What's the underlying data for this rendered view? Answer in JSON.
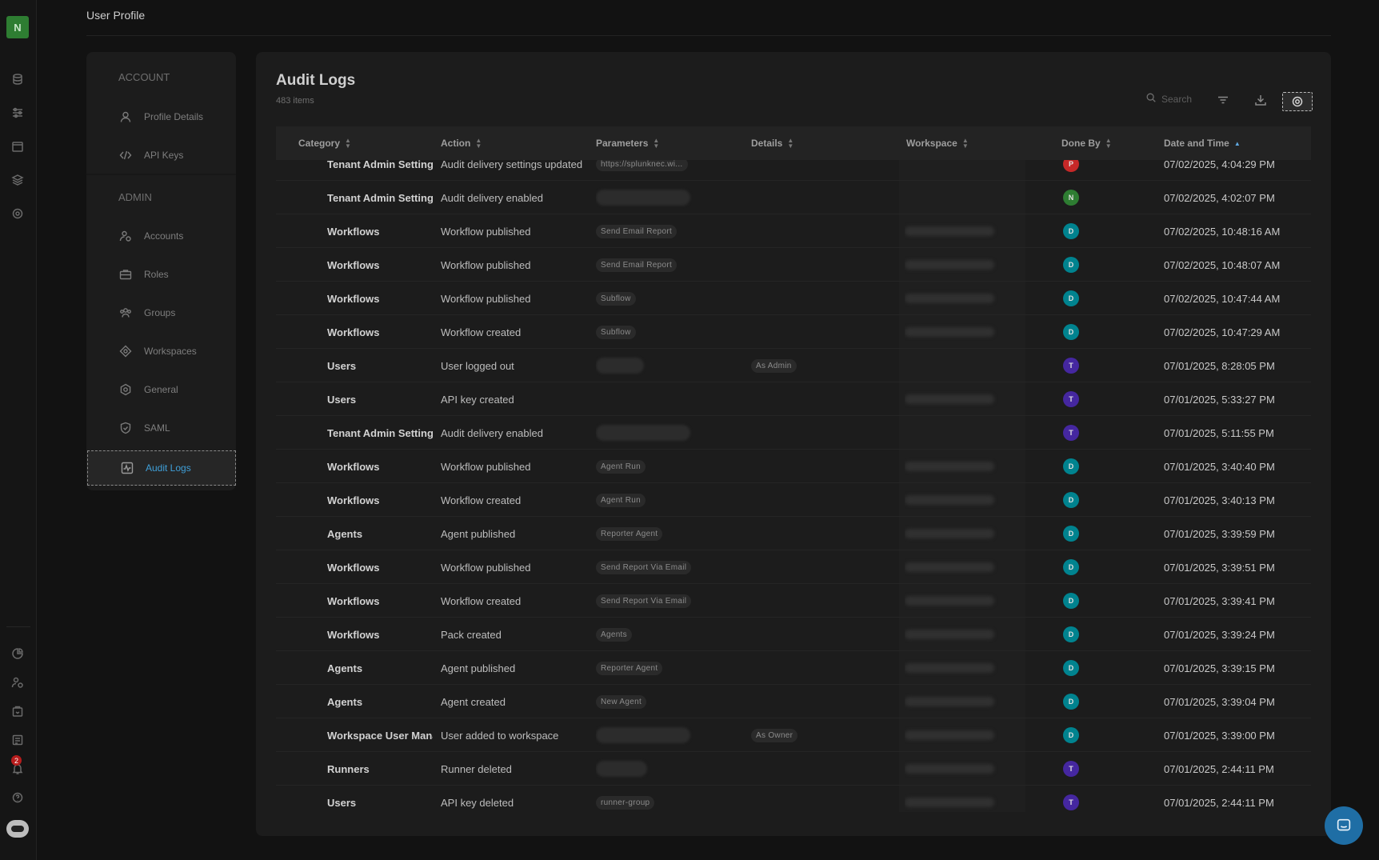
{
  "app": {
    "logo_letter": "N",
    "page_title": "User Profile",
    "notification_count": "2"
  },
  "nav": {
    "account_label": "ACCOUNT",
    "admin_label": "ADMIN",
    "account_items": [
      {
        "label": "Profile Details",
        "icon": "user-icon"
      },
      {
        "label": "API Keys",
        "icon": "code-icon"
      }
    ],
    "admin_items": [
      {
        "label": "Accounts",
        "icon": "accounts-icon"
      },
      {
        "label": "Roles",
        "icon": "briefcase-icon"
      },
      {
        "label": "Groups",
        "icon": "groups-icon"
      },
      {
        "label": "Workspaces",
        "icon": "workspace-icon"
      },
      {
        "label": "General",
        "icon": "gear-icon"
      },
      {
        "label": "SAML",
        "icon": "shield-icon"
      },
      {
        "label": "Audit Logs",
        "icon": "activity-icon",
        "active": true
      }
    ]
  },
  "audit": {
    "title": "Audit Logs",
    "count": "483 items",
    "search_placeholder": "Search",
    "columns": [
      "Category",
      "Action",
      "Parameters",
      "Details",
      "Workspace",
      "Done By",
      "Date and Time"
    ],
    "rows": [
      {
        "category": "Tenant Admin Setting",
        "action": "Audit delivery settings updated",
        "param": "https://splunknec.wi...",
        "param_blur": false,
        "details": "",
        "ws": false,
        "avatar": "P",
        "color": "#c62828",
        "date": "07/02/2025, 4:04:29 PM"
      },
      {
        "category": "Tenant Admin Setting",
        "action": "Audit delivery enabled",
        "param": "",
        "param_blur": true,
        "blur_w": 118,
        "details": "",
        "ws": false,
        "avatar": "N",
        "color": "#2e7d32",
        "date": "07/02/2025, 4:02:07 PM"
      },
      {
        "category": "Workflows",
        "action": "Workflow published",
        "param": "Send Email Report",
        "details": "",
        "ws": true,
        "avatar": "D",
        "color": "#00838f",
        "date": "07/02/2025, 10:48:16 AM"
      },
      {
        "category": "Workflows",
        "action": "Workflow published",
        "param": "Send Email Report",
        "details": "",
        "ws": true,
        "avatar": "D",
        "color": "#00838f",
        "date": "07/02/2025, 10:48:07 AM"
      },
      {
        "category": "Workflows",
        "action": "Workflow published",
        "param": "Subflow",
        "details": "",
        "ws": true,
        "avatar": "D",
        "color": "#00838f",
        "date": "07/02/2025, 10:47:44 AM"
      },
      {
        "category": "Workflows",
        "action": "Workflow created",
        "param": "Subflow",
        "details": "",
        "ws": true,
        "avatar": "D",
        "color": "#00838f",
        "date": "07/02/2025, 10:47:29 AM"
      },
      {
        "category": "Users",
        "action": "User logged out",
        "param": "",
        "param_blur": true,
        "blur_w": 60,
        "details": "As Admin",
        "ws": false,
        "avatar": "T",
        "color": "#4527a0",
        "date": "07/01/2025, 8:28:05 PM"
      },
      {
        "category": "Users",
        "action": "API key created",
        "param": "",
        "param_blur": false,
        "details": "",
        "ws": true,
        "avatar": "T",
        "color": "#4527a0",
        "date": "07/01/2025, 5:33:27 PM"
      },
      {
        "category": "Tenant Admin Setting",
        "action": "Audit delivery enabled",
        "param": "",
        "param_blur": true,
        "blur_w": 118,
        "details": "",
        "ws": false,
        "avatar": "T",
        "color": "#4527a0",
        "date": "07/01/2025, 5:11:55 PM"
      },
      {
        "category": "Workflows",
        "action": "Workflow published",
        "param": "Agent Run",
        "details": "",
        "ws": true,
        "avatar": "D",
        "color": "#00838f",
        "date": "07/01/2025, 3:40:40 PM"
      },
      {
        "category": "Workflows",
        "action": "Workflow created",
        "param": "Agent Run",
        "details": "",
        "ws": true,
        "avatar": "D",
        "color": "#00838f",
        "date": "07/01/2025, 3:40:13 PM"
      },
      {
        "category": "Agents",
        "action": "Agent published",
        "param": "Reporter Agent",
        "details": "",
        "ws": true,
        "avatar": "D",
        "color": "#00838f",
        "date": "07/01/2025, 3:39:59 PM"
      },
      {
        "category": "Workflows",
        "action": "Workflow published",
        "param": "Send Report Via Email",
        "details": "",
        "ws": true,
        "avatar": "D",
        "color": "#00838f",
        "date": "07/01/2025, 3:39:51 PM"
      },
      {
        "category": "Workflows",
        "action": "Workflow created",
        "param": "Send Report Via Email",
        "details": "",
        "ws": true,
        "avatar": "D",
        "color": "#00838f",
        "date": "07/01/2025, 3:39:41 PM"
      },
      {
        "category": "Workflows",
        "action": "Pack created",
        "param": "Agents",
        "details": "",
        "ws": true,
        "avatar": "D",
        "color": "#00838f",
        "date": "07/01/2025, 3:39:24 PM"
      },
      {
        "category": "Agents",
        "action": "Agent published",
        "param": "Reporter Agent",
        "details": "",
        "ws": true,
        "avatar": "D",
        "color": "#00838f",
        "date": "07/01/2025, 3:39:15 PM"
      },
      {
        "category": "Agents",
        "action": "Agent created",
        "param": "New Agent",
        "details": "",
        "ws": true,
        "avatar": "D",
        "color": "#00838f",
        "date": "07/01/2025, 3:39:04 PM"
      },
      {
        "category": "Workspace User Management",
        "action": "User added to workspace",
        "param": "",
        "param_blur": true,
        "blur_w": 118,
        "details": "As Owner",
        "ws": true,
        "avatar": "D",
        "color": "#00838f",
        "date": "07/01/2025, 3:39:00 PM"
      },
      {
        "category": "Runners",
        "action": "Runner deleted",
        "param": "",
        "param_blur": true,
        "blur_w": 64,
        "details": "",
        "ws": true,
        "avatar": "T",
        "color": "#4527a0",
        "date": "07/01/2025, 2:44:11 PM"
      },
      {
        "category": "Users",
        "action": "API key deleted",
        "param": "runner-group",
        "details": "",
        "ws": true,
        "avatar": "T",
        "color": "#4527a0",
        "date": "07/01/2025, 2:44:11 PM"
      }
    ]
  }
}
